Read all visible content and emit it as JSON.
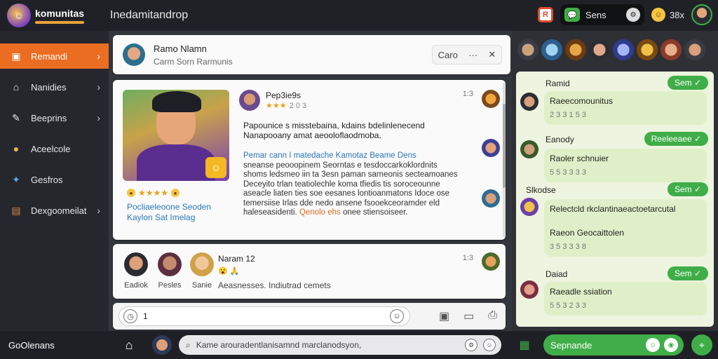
{
  "app": {
    "logo_name": "komunitas",
    "title": "Inedamitandrop"
  },
  "topbar": {
    "badge_letter": "R",
    "pill_label": "Sens",
    "count": "38x"
  },
  "sidebar": {
    "items": [
      {
        "label": "Remandi",
        "icon": "image-icon",
        "active": true
      },
      {
        "label": "Nanidies",
        "icon": "home-icon",
        "active": false
      },
      {
        "label": "Beeprins",
        "icon": "chat-icon",
        "active": false
      },
      {
        "label": "Aceelcole",
        "icon": "globe-icon",
        "active": false
      },
      {
        "label": "Gesfros",
        "icon": "puzzle-icon",
        "active": false
      },
      {
        "label": "Dexgoomeilat",
        "icon": "folder-icon",
        "active": false
      }
    ],
    "bottom_label": "GoOlenans"
  },
  "header": {
    "name": "Ramo Nlamn",
    "subtitle": "Carm Sorn Rarmunis",
    "action_label": "Caro",
    "action_dots": "···",
    "action_close": "✕"
  },
  "post": {
    "author": "Pep3ie9s",
    "stars": "★★★",
    "stars_num": "2 0 3",
    "time": "1:3",
    "rating": "★★★★",
    "left_text_1": "Pocliaeleoone Seoden",
    "left_text_2": "Kaylon Sat Imelag",
    "body": "Papounice s misstebaina, kdains bdelinlenecend Nanapooany amat aeooloflaodmoba.",
    "body2_lead": "Pemar cann I matedache Kamotaz Beame Dens",
    "body2": "sneanse peooopinem Seorntas e tesdoccarkoklordnits shoms ledsmeo iin ta 3esn paman sarneonis secteamoanes Deceyito trlan teatiolechle koma tfiedis tis soroceounne aseacle liaten ties soe eesanes lontioanmatons Idoce ose temersiise Irlas dde nedo ansene fsooekceoramder eld haleseasidenti.",
    "body2_hl": "Qenolo ehs",
    "body2_tail": "onee stiensoiseer."
  },
  "group": {
    "members": [
      {
        "name": "Eadiok"
      },
      {
        "name": "Pesles"
      },
      {
        "name": "Sanie"
      }
    ],
    "title": "Naram 12",
    "emoji": "😮 🙏",
    "desc": "Aeasnesses. Indiutrad cemets",
    "time": "1:3"
  },
  "compose": {
    "value": "1"
  },
  "chat": {
    "messages": [
      {
        "name": "Ramid",
        "tag": "Sem ✓",
        "text": "Raeecomounitus",
        "time": "2 3 3   1 5 3"
      },
      {
        "name": "Eanody",
        "tag": "Reeleeaee ✓",
        "text": "Raoler schnuier",
        "time": "5 5 3   3 3 3"
      },
      {
        "name": "Slkodse",
        "tag": "Sem ✓",
        "text": "Relectcld rkclantinaeactoetarcutal",
        "text2": "Raeon Geocaittolen",
        "time": "3 5 3   3 3 8"
      },
      {
        "name": "Daiad",
        "tag": "Sem ✓",
        "text": "Raeadle ssiation",
        "time": "5 5 3   2 3 3"
      }
    ]
  },
  "bottombar": {
    "search_placeholder": "Kame arouradentlanisamnd marclanodsyon,",
    "send_label": "Sepnande"
  },
  "colors": {
    "accent_orange": "#ea6d22",
    "accent_green": "#3fae48",
    "dark_bg": "#25272d"
  }
}
